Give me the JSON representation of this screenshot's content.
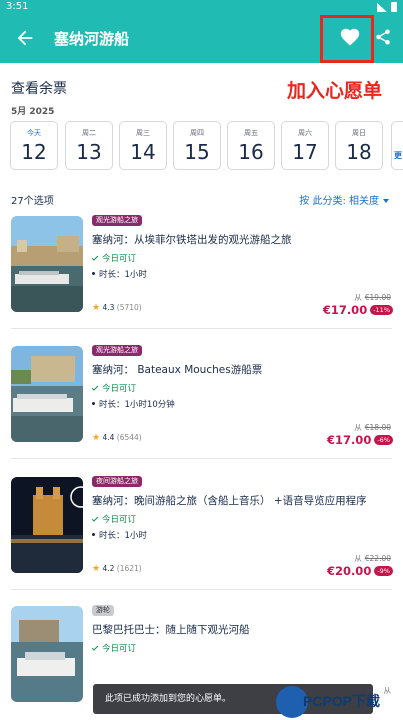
{
  "status_bar": {
    "time": "3:51"
  },
  "app_bar": {
    "title": "塞纳河游船"
  },
  "annotation": "加入心愿单",
  "availability": {
    "title": "查看余票",
    "month": "5月 2025",
    "dates": [
      {
        "weekday": "今天",
        "day": "12"
      },
      {
        "weekday": "周二",
        "day": "13"
      },
      {
        "weekday": "周三",
        "day": "14"
      },
      {
        "weekday": "周四",
        "day": "15"
      },
      {
        "weekday": "周五",
        "day": "16"
      },
      {
        "weekday": "周六",
        "day": "17"
      },
      {
        "weekday": "周日",
        "day": "18"
      }
    ],
    "more_label": "更"
  },
  "results": {
    "count": "27个选项",
    "sort_label": "按 此分类: 相关度"
  },
  "cards": [
    {
      "badge": "观光游船之旅",
      "name": "塞纳河：从埃菲尔铁塔出发的观光游船之旅",
      "availability": "今日可订",
      "duration": "时长：1小时",
      "rating": "4.3",
      "rating_count": "(5710)",
      "from": "从",
      "old_price": "€19.00",
      "price": "€17.00",
      "discount": "-11%"
    },
    {
      "badge": "观光游船之旅",
      "name": "塞纳河： Bateaux Mouches游船票",
      "availability": "今日可订",
      "duration": "时长：1小时10分钟",
      "rating": "4.4",
      "rating_count": "(6544)",
      "from": "从",
      "old_price": "€18.00",
      "price": "€17.00",
      "discount": "-6%"
    },
    {
      "badge": "夜间游船之旅",
      "name": "塞纳河：晚间游船之旅（含船上音乐） +语音导览应用程序",
      "availability": "今日可订",
      "duration": "时长：1小时",
      "rating": "4.2",
      "rating_count": "(1621)",
      "from": "从",
      "old_price": "€22.00",
      "price": "€20.00",
      "discount": "-9%"
    },
    {
      "badge": "游轮",
      "name": "巴黎巴托巴士：随上随下观光河船",
      "availability": "今日可订",
      "from": "从"
    }
  ],
  "toast": "此项已成功添加到您的心愿单。",
  "watermark": "PCPOP下载",
  "colors": {
    "primary": "#20bcb4",
    "price": "#c4164b",
    "highlight": "#e8271f",
    "link": "#1a6fd1"
  }
}
